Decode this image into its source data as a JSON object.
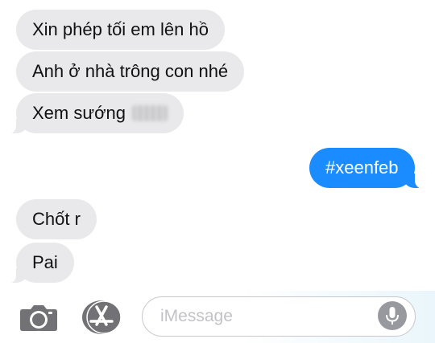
{
  "messages": [
    {
      "direction": "incoming",
      "text": "Xin phép tối em lên hồ"
    },
    {
      "direction": "incoming",
      "text": "Anh ở nhà trông con nhé"
    },
    {
      "direction": "incoming",
      "text": "Xem sướng"
    },
    {
      "direction": "outgoing",
      "text": "#xeenfeb"
    },
    {
      "direction": "incoming",
      "text": "Chốt r"
    },
    {
      "direction": "incoming",
      "text": "Pai"
    }
  ],
  "composer": {
    "placeholder": "iMessage",
    "icons": [
      "camera-icon",
      "app-store-icon",
      "microphone-icon"
    ]
  },
  "colors": {
    "incoming_bubble": "#e9e9eb",
    "outgoing_bubble": "#1a8cff",
    "icon_gray": "#717176"
  }
}
